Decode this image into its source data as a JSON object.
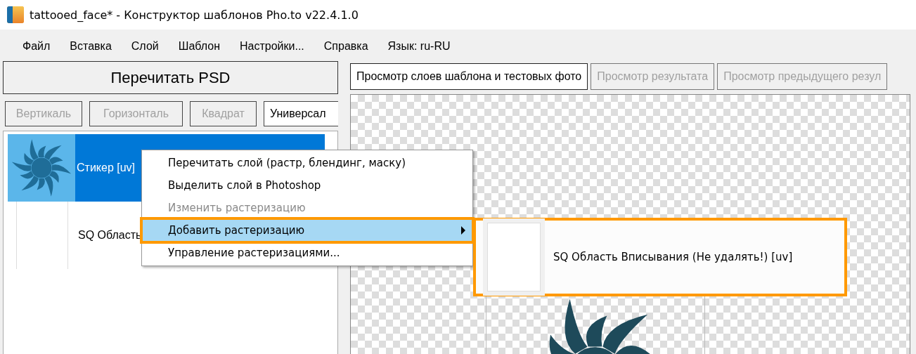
{
  "window": {
    "title": "tattooed_face* - Конструктор шаблонов Pho.to v22.4.1.0"
  },
  "menu": [
    "Файл",
    "Вставка",
    "Слой",
    "Шаблон",
    "Настройки...",
    "Справка",
    "Язык: ru-RU"
  ],
  "reread_button": "Перечитать PSD",
  "filters": [
    {
      "label": "Вертикаль",
      "selected": false
    },
    {
      "label": "Горизонталь",
      "selected": false
    },
    {
      "label": "Квадрат",
      "selected": false
    },
    {
      "label": "Универсал",
      "selected": true
    }
  ],
  "layers": [
    {
      "name": "Стикер [uv]",
      "kind": "sticker",
      "selected": true
    },
    {
      "name": "SQ Область",
      "kind": "blank",
      "selected": false
    }
  ],
  "tabs": [
    {
      "label": "Просмотр слоев шаблона и тестовых фото",
      "selected": true
    },
    {
      "label": "Просмотр результата",
      "selected": false
    },
    {
      "label": "Просмотр предыдущего резул",
      "selected": false
    }
  ],
  "context_menu": {
    "items": [
      {
        "label": "Перечитать слой (растр, блендинг, маску)",
        "disabled": false,
        "selected": false,
        "submenu": false,
        "highlighted": false
      },
      {
        "label": "Выделить слой в Photoshop",
        "disabled": false,
        "selected": false,
        "submenu": false,
        "highlighted": false
      },
      {
        "label": "Изменить растеризацию",
        "disabled": true,
        "selected": false,
        "submenu": false,
        "highlighted": false
      },
      {
        "label": "Добавить растеризацию",
        "disabled": false,
        "selected": true,
        "submenu": true,
        "highlighted": true
      },
      {
        "label": "Управление растеризациями...",
        "disabled": false,
        "selected": false,
        "submenu": false,
        "highlighted": false
      }
    ]
  },
  "submenu": {
    "highlighted": true,
    "items": [
      {
        "label": "SQ Область Вписывания (Не удалять!) [uv]",
        "kind": "blank"
      }
    ]
  }
}
